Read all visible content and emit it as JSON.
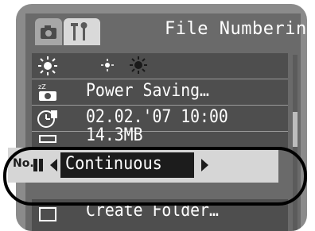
{
  "header": {
    "title": "File Numbering",
    "tabs": [
      {
        "label": "",
        "icon": "camera-icon"
      },
      {
        "label": "",
        "icon": "tools-icon"
      }
    ]
  },
  "menu": {
    "rows": [
      {
        "label": "",
        "icon": "brightness-icon"
      },
      {
        "label": "Power Saving…",
        "icon": "power-saving-icon"
      },
      {
        "label": "02.02.'07 10:00",
        "icon": "date-time-icon"
      },
      {
        "label": "14.3MB",
        "icon": "format-icon"
      },
      {
        "label": "Create Folder…",
        "icon": "folder-icon"
      }
    ],
    "selected": {
      "icon_label": "No.",
      "value": "Continuous",
      "icon": "file-numbering-icon"
    }
  },
  "colors": {
    "accent": "#1c1c1c",
    "selected_bg": "#d6d6d6",
    "screen_bg": "#6a6a6a",
    "row_bg": "#4e4e4e"
  }
}
